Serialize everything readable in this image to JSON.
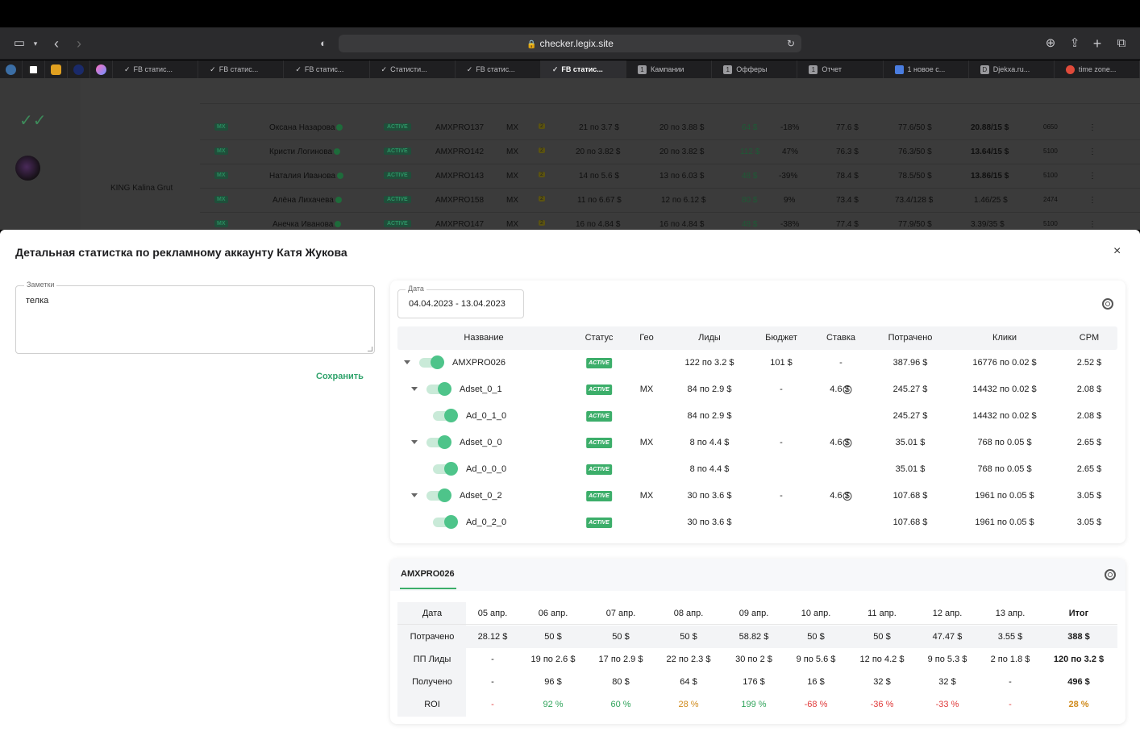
{
  "browser": {
    "url": "checker.legix.site",
    "tabs": [
      {
        "label": "FB статис...",
        "icon": "check-icon"
      },
      {
        "label": "FB статис...",
        "icon": "check-icon"
      },
      {
        "label": "FB статис...",
        "icon": "check-icon"
      },
      {
        "label": "Статисти...",
        "icon": "check-icon"
      },
      {
        "label": "FB статис...",
        "icon": "check-icon"
      },
      {
        "label": "FB статис...",
        "icon": "check-icon",
        "active": true
      },
      {
        "label": "Кампании",
        "icon": "num-1-icon",
        "badge": "1"
      },
      {
        "label": "Офферы",
        "icon": "num-1-icon",
        "badge": "1"
      },
      {
        "label": "Отчет",
        "icon": "num-1-icon",
        "badge": "1"
      },
      {
        "label": "1 новое с...",
        "icon": "chat-icon"
      },
      {
        "label": "Djekxa.ru...",
        "icon": "d-icon",
        "badge": "D"
      },
      {
        "label": "time zone...",
        "icon": "globe-icon"
      }
    ]
  },
  "background": {
    "group_label": "KING Kalina Grut",
    "rows": [
      {
        "geo": "MX",
        "name": "Оксана Назарова",
        "status": "ACTIVE",
        "acc": "AMXPRO137",
        "geo2": "MX",
        "n": "2",
        "a": "21 по 3.7 $",
        "b": "20 по 3.88 $",
        "c": "64 $",
        "d": "-18%",
        "e": "77.6 $",
        "f": "77.6/50 $",
        "g": "20.88/15 $",
        "h": "0650"
      },
      {
        "geo": "MX",
        "name": "Кристи Логинова",
        "status": "ACTIVE",
        "acc": "AMXPRO142",
        "geo2": "MX",
        "n": "2",
        "a": "20 по 3.82 $",
        "b": "20 по 3.82 $",
        "c": "112 $",
        "d": "47%",
        "e": "76.3 $",
        "f": "76.3/50 $",
        "g": "13.64/15 $",
        "h": "5100"
      },
      {
        "geo": "MX",
        "name": "Наталия Иванова",
        "status": "ACTIVE",
        "acc": "AMXPRO143",
        "geo2": "MX",
        "n": "2",
        "a": "14 по 5.6 $",
        "b": "13 по 6.03 $",
        "c": "48 $",
        "d": "-39%",
        "e": "78.4 $",
        "f": "78.5/50 $",
        "g": "13.86/15 $",
        "h": "5100"
      },
      {
        "geo": "MX",
        "name": "Алёна Лихачева",
        "status": "ACTIVE",
        "acc": "AMXPRO158",
        "geo2": "MX",
        "n": "2",
        "a": "11 по 6.67 $",
        "b": "12 по 6.12 $",
        "c": "80 $",
        "d": "9%",
        "e": "73.4 $",
        "f": "73.4/128 $",
        "g": "1.46/25 $",
        "h": "2474"
      },
      {
        "geo": "MX",
        "name": "Анечка Иванова",
        "status": "ACTIVE",
        "acc": "AMXPRO147",
        "geo2": "MX",
        "n": "2",
        "a": "16 по 4.84 $",
        "b": "16 по 4.84 $",
        "c": "48 $",
        "d": "-38%",
        "e": "77.4 $",
        "f": "77.9/50 $",
        "g": "3.39/35 $",
        "h": "5100"
      }
    ]
  },
  "modal": {
    "title": "Детальная статистка по рекламному аккаунту Катя Жукова",
    "close": "×",
    "notes_label": "Заметки",
    "notes_value": "телка",
    "save_label": "Сохранить",
    "date_label": "Дата",
    "date_value": "04.04.2023 - 13.04.2023",
    "columns": [
      "Название",
      "Статус",
      "Гео",
      "Лиды",
      "Бюджет",
      "Ставка",
      "Потрачено",
      "Клики",
      "CPM"
    ],
    "rows": [
      {
        "name": "AMXPRO026",
        "level": 0,
        "caret": true,
        "status": "ACTIVE",
        "geo": "",
        "leads": "122 по 3.2 $",
        "budget": "101 $",
        "bid": "-",
        "bid_info": false,
        "spent": "387.96 $",
        "clicks": "16776 по 0.02 $",
        "cpm": "2.52 $"
      },
      {
        "name": "Adset_0_1",
        "level": 1,
        "caret": true,
        "status": "ACTIVE",
        "geo": "MX",
        "leads": "84 по 2.9 $",
        "budget": "-",
        "bid": "4.6 $",
        "bid_info": true,
        "spent": "245.27 $",
        "clicks": "14432 по 0.02 $",
        "cpm": "2.08 $"
      },
      {
        "name": "Ad_0_1_0",
        "level": 2,
        "caret": false,
        "status": "ACTIVE",
        "geo": "",
        "leads": "84 по 2.9 $",
        "budget": "",
        "bid": "",
        "bid_info": false,
        "spent": "245.27 $",
        "clicks": "14432 по 0.02 $",
        "cpm": "2.08 $"
      },
      {
        "name": "Adset_0_0",
        "level": 1,
        "caret": true,
        "status": "ACTIVE",
        "geo": "MX",
        "leads": "8 по 4.4 $",
        "budget": "-",
        "bid": "4.6 $",
        "bid_info": true,
        "spent": "35.01 $",
        "clicks": "768 по 0.05 $",
        "cpm": "2.65 $"
      },
      {
        "name": "Ad_0_0_0",
        "level": 2,
        "caret": false,
        "status": "ACTIVE",
        "geo": "",
        "leads": "8 по 4.4 $",
        "budget": "",
        "bid": "",
        "bid_info": false,
        "spent": "35.01 $",
        "clicks": "768 по 0.05 $",
        "cpm": "2.65 $"
      },
      {
        "name": "Adset_0_2",
        "level": 1,
        "caret": true,
        "status": "ACTIVE",
        "geo": "MX",
        "leads": "30 по 3.6 $",
        "budget": "-",
        "bid": "4.6 $",
        "bid_info": true,
        "spent": "107.68 $",
        "clicks": "1961 по 0.05 $",
        "cpm": "3.05 $"
      },
      {
        "name": "Ad_0_2_0",
        "level": 2,
        "caret": false,
        "status": "ACTIVE",
        "geo": "",
        "leads": "30 по 3.6 $",
        "budget": "",
        "bid": "",
        "bid_info": false,
        "spent": "107.68 $",
        "clicks": "1961 по 0.05 $",
        "cpm": "3.05 $"
      }
    ],
    "daily": {
      "account": "AMXPRO026",
      "header": [
        "Дата",
        "05 апр.",
        "06 апр.",
        "07 апр.",
        "08 апр.",
        "09 апр.",
        "10 апр.",
        "11 апр.",
        "12 апр.",
        "13 апр.",
        "Итог"
      ],
      "rows": [
        {
          "label": "Потрачено",
          "values": [
            "28.12 $",
            "50 $",
            "50 $",
            "50 $",
            "58.82 $",
            "50 $",
            "50 $",
            "47.47 $",
            "3.55 $",
            "388 $"
          ]
        },
        {
          "label": "ПП Лиды",
          "values": [
            "-",
            "19 по 2.6 $",
            "17 по 2.9 $",
            "22 по 2.3 $",
            "30 по 2 $",
            "9 по 5.6 $",
            "12 по 4.2 $",
            "9 по 5.3 $",
            "2 по 1.8 $",
            "120 по 3.2 $"
          ]
        },
        {
          "label": "Получено",
          "values": [
            "-",
            "96 $",
            "80 $",
            "64 $",
            "176 $",
            "16 $",
            "32 $",
            "32 $",
            "-",
            "496 $"
          ]
        },
        {
          "label": "ROI",
          "values": [
            "-",
            "92 %",
            "60 %",
            "28 %",
            "199 %",
            "-68 %",
            "-36 %",
            "-33 %",
            "-",
            "28 %"
          ],
          "tones": [
            "neg",
            "pos",
            "pos",
            "mid",
            "pos",
            "neg",
            "neg",
            "neg",
            "neg",
            "mid"
          ]
        }
      ]
    }
  },
  "colors": {
    "accent": "#3cae6a",
    "positive": "#2fa35a",
    "negative": "#e03a3a",
    "neutral": "#d08a1a"
  }
}
